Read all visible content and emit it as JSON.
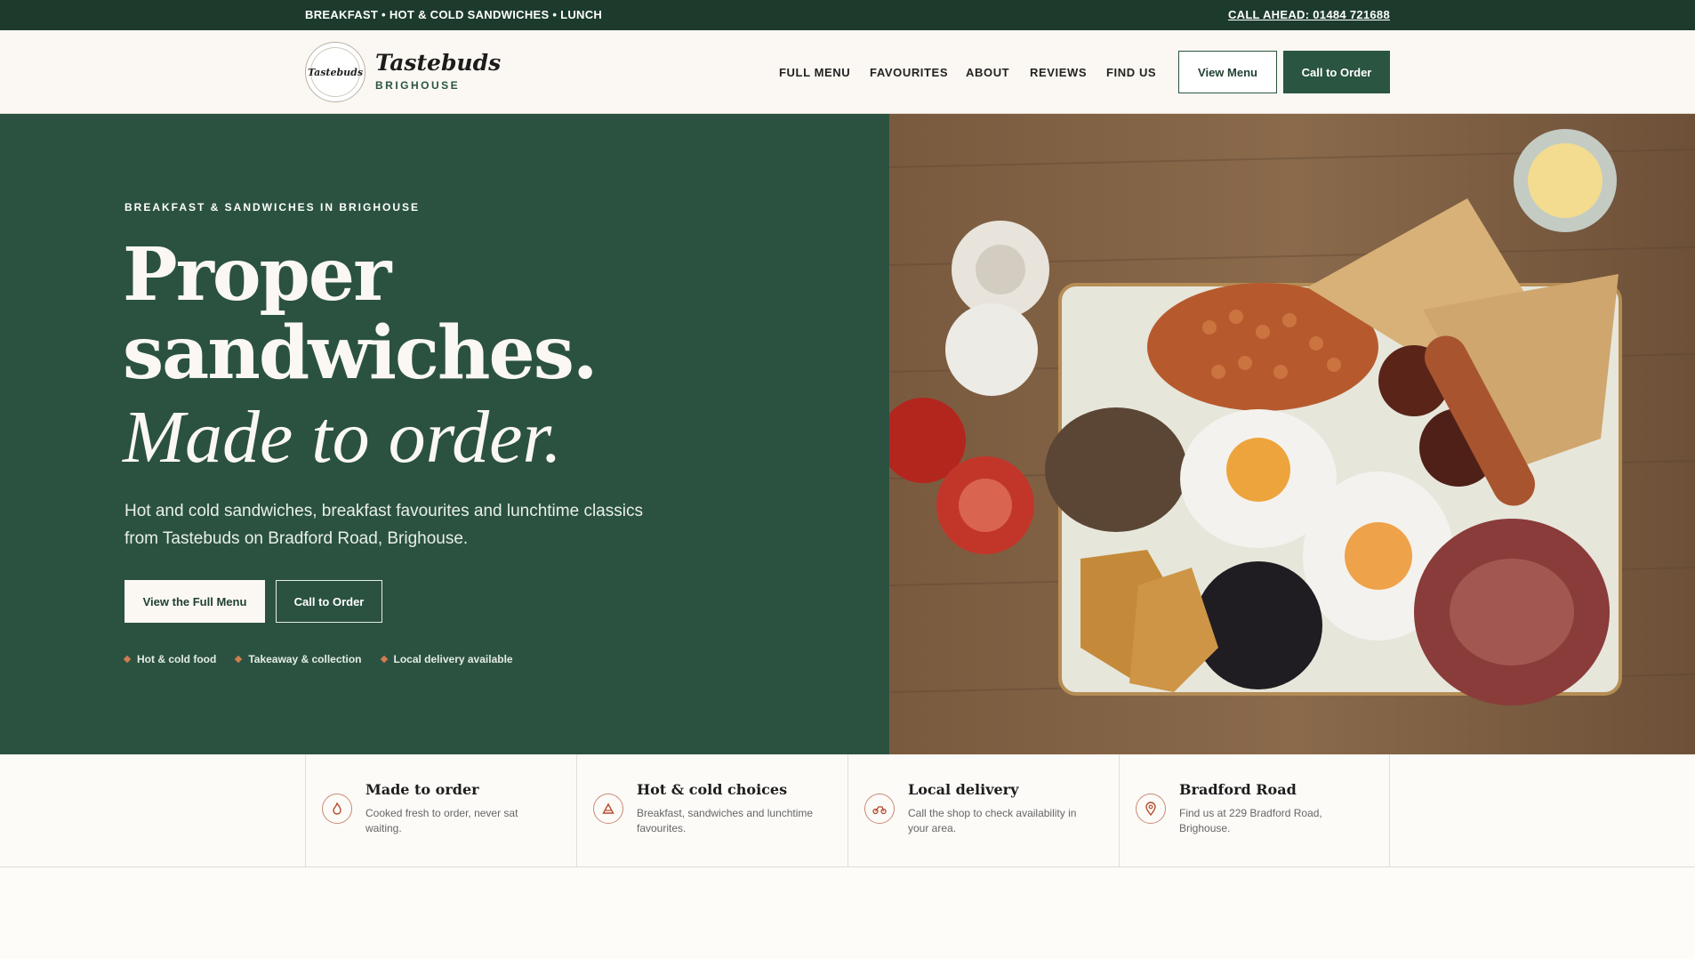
{
  "topbar": {
    "tagline": "BREAKFAST • HOT & COLD SANDWICHES • LUNCH",
    "call_ahead": "CALL AHEAD: 01484 721688"
  },
  "header": {
    "logo_text": "Tastebuds",
    "brand_name": "Tastebuds",
    "brand_sub": "BRIGHOUSE",
    "nav": [
      "FULL MENU",
      "FAVOURITES",
      "ABOUT",
      "REVIEWS",
      "FIND US"
    ],
    "view_menu_label": "View Menu",
    "call_label": "Call to Order"
  },
  "hero": {
    "eyebrow": "BREAKFAST & SANDWICHES IN BRIGHOUSE",
    "headline_1": "Proper",
    "headline_2": "sandwiches.",
    "headline_3": "Made to order.",
    "copy": "Hot and cold sandwiches, breakfast favourites and lunchtime classics from Tastebuds on Bradford Road, Brighouse.",
    "primary_button": "View the Full Menu",
    "secondary_button": "Call to Order",
    "tags": [
      "Hot & cold food",
      "Takeaway & collection",
      "Local delivery available"
    ]
  },
  "features": [
    {
      "icon": "flame-icon",
      "title": "Made to order",
      "text": "Cooked fresh to order, never sat waiting."
    },
    {
      "icon": "triangle-icon",
      "title": "Hot & cold choices",
      "text": "Breakfast, sandwiches and lunchtime favourites."
    },
    {
      "icon": "scooter-icon",
      "title": "Local delivery",
      "text": "Call the shop to check availability in your area."
    },
    {
      "icon": "location-pin-icon",
      "title": "Bradford Road",
      "text": "Find us at 229 Bradford Road, Brighouse."
    }
  ],
  "colors": {
    "brand_green": "#2b5240",
    "dark_green": "#1d3b2d",
    "cream": "#fbf8f3",
    "accent": "#b64b2b"
  }
}
